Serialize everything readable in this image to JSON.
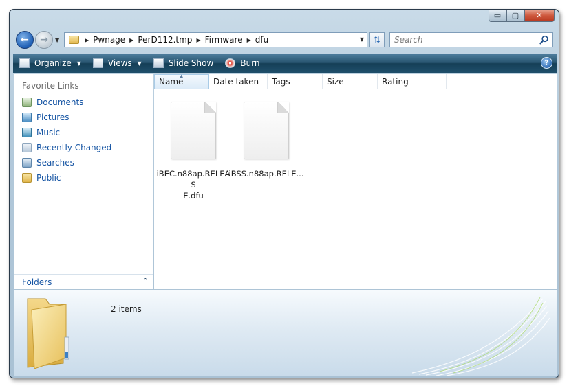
{
  "window": {
    "caption_buttons": {
      "minimize": "▭",
      "maximize": "▢",
      "close": "✕"
    }
  },
  "address_bar": {
    "breadcrumbs": [
      "Pwnage",
      "PerD112.tmp",
      "Firmware",
      "dfu"
    ]
  },
  "search": {
    "placeholder": "Search"
  },
  "command_bar": {
    "organize": "Organize",
    "views": "Views",
    "slideshow": "Slide Show",
    "burn": "Burn",
    "help": "?"
  },
  "nav_pane": {
    "title": "Favorite Links",
    "links": [
      {
        "label": "Documents",
        "icon": "documents-icon"
      },
      {
        "label": "Pictures",
        "icon": "pictures-icon"
      },
      {
        "label": "Music",
        "icon": "music-icon"
      },
      {
        "label": "Recently Changed",
        "icon": "recently-changed-icon"
      },
      {
        "label": "Searches",
        "icon": "searches-icon"
      },
      {
        "label": "Public",
        "icon": "public-folder-icon"
      }
    ],
    "folders_label": "Folders"
  },
  "columns": [
    "Name",
    "Date taken",
    "Tags",
    "Size",
    "Rating"
  ],
  "files": [
    {
      "name": "iBEC.n88ap.RELEASE.dfu",
      "label_line1": "iBEC.n88ap.RELEAS",
      "label_line2": "E.dfu"
    },
    {
      "name": "iBSS.n88ap.RELE...",
      "label_line1": "iBSS.n88ap.RELE...",
      "label_line2": ""
    }
  ],
  "details": {
    "item_count": "2 items"
  },
  "colors": {
    "command_bar": "#1f4f6b",
    "link": "#1554a3",
    "window_frame": "#b4cadb"
  }
}
